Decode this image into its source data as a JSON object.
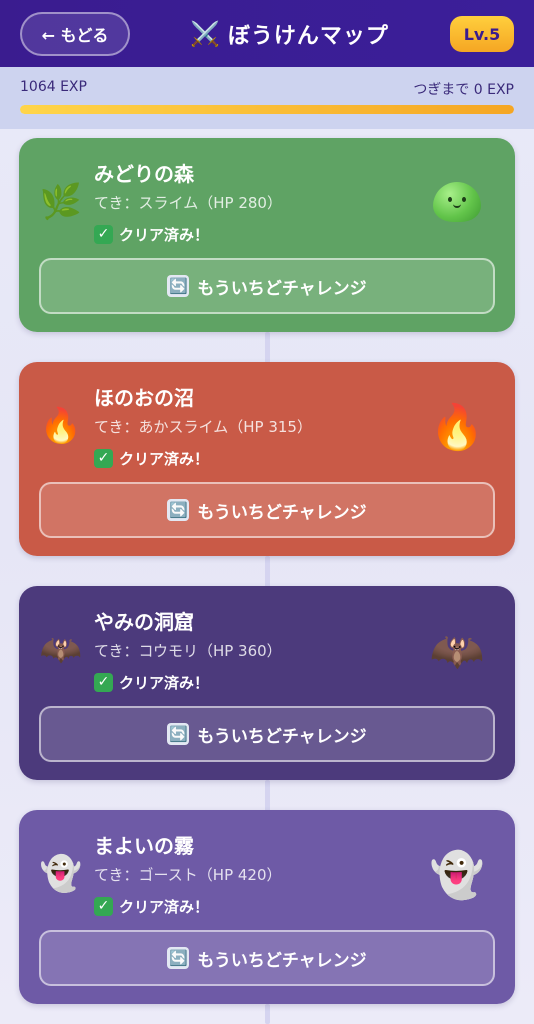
{
  "header": {
    "back_label": "← もどる",
    "title_icon": "⚔️",
    "title": "ぼうけんマップ",
    "level": "Lv.5"
  },
  "exp": {
    "current": "1064 EXP",
    "next": "つぎまで 0 EXP",
    "progress_fraction": 1.0
  },
  "stages": [
    {
      "name": "みどりの森",
      "enemy": "てき：スライム（HP 280）",
      "status": "クリア済み！",
      "retry_label": "もういちどチャレンジ",
      "left_icon": "🌿",
      "right_icon": "slime",
      "color": "#5fa364"
    },
    {
      "name": "ほのおの沼",
      "enemy": "てき：あかスライム（HP 315）",
      "status": "クリア済み！",
      "retry_label": "もういちどチャレンジ",
      "left_icon": "🔥",
      "right_icon": "🔥",
      "color": "#c95a47"
    },
    {
      "name": "やみの洞窟",
      "enemy": "てき：コウモリ（HP 360）",
      "status": "クリア済み！",
      "retry_label": "もういちどチャレンジ",
      "left_icon": "🦇",
      "right_icon": "🦇",
      "color": "#4c3a7c"
    },
    {
      "name": "まよいの霧",
      "enemy": "てき：ゴースト（HP 420）",
      "status": "クリア済み！",
      "retry_label": "もういちどチャレンジ",
      "left_icon": "👻",
      "right_icon": "👻",
      "color": "#6e5aa6"
    }
  ],
  "icons": {
    "check": "✓",
    "retry": "🔄"
  }
}
